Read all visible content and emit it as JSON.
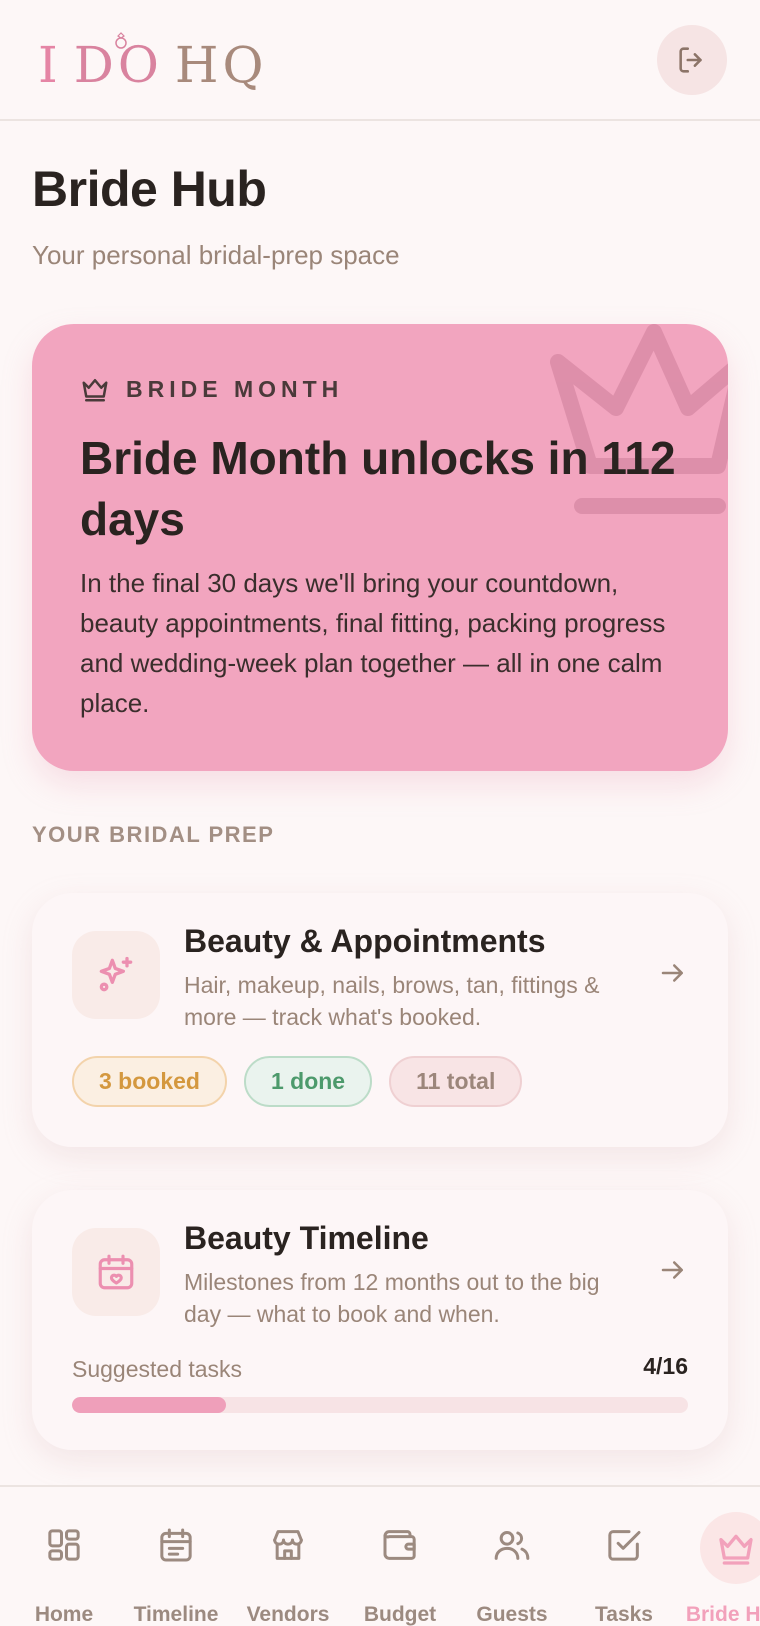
{
  "app": {
    "logo": {
      "part1": "I",
      "part2": "DO",
      "part3": "HQ"
    },
    "logout_icon": "logout-icon"
  },
  "page": {
    "title": "Bride Hub",
    "subtitle": "Your personal bridal-prep space"
  },
  "hero": {
    "kicker": "BRIDE MONTH",
    "title": "Bride Month unlocks in 112 days",
    "body": "In the final 30 days we'll bring your countdown, beauty appointments, final fitting, packing progress and wedding-week plan together — all in one calm place.",
    "icon": "crown-icon",
    "color": "#f2a5bf"
  },
  "section": {
    "label": "YOUR BRIDAL PREP"
  },
  "cards": [
    {
      "title": "Beauty & Appointments",
      "description": "Hair, makeup, nails, brows, tan, fittings & more — track what's booked.",
      "icon": "sparkles-icon",
      "chips": {
        "booked": "3 booked",
        "done": "1 done",
        "total": "11 total"
      }
    },
    {
      "title": "Beauty Timeline",
      "description": "Milestones from 12 months out to the big day — what to book and when.",
      "icon": "calendar-heart-icon",
      "progress_label": "Suggested tasks",
      "progress_value": "4/16",
      "progress_fraction": 0.25
    }
  ],
  "nav": {
    "items": [
      {
        "label": "Home",
        "icon": "grid-icon"
      },
      {
        "label": "Timeline",
        "icon": "calendar-icon"
      },
      {
        "label": "Vendors",
        "icon": "store-icon"
      },
      {
        "label": "Budget",
        "icon": "wallet-icon"
      },
      {
        "label": "Guests",
        "icon": "users-icon"
      },
      {
        "label": "Tasks",
        "icon": "checkbox-icon"
      },
      {
        "label": "Bride Hub",
        "icon": "crown-icon",
        "active": true
      }
    ]
  },
  "colors": {
    "accent_pink": "#f2a1bb",
    "booked": "#d4983f",
    "done": "#4d9a6c",
    "muted": "#9a8578"
  }
}
